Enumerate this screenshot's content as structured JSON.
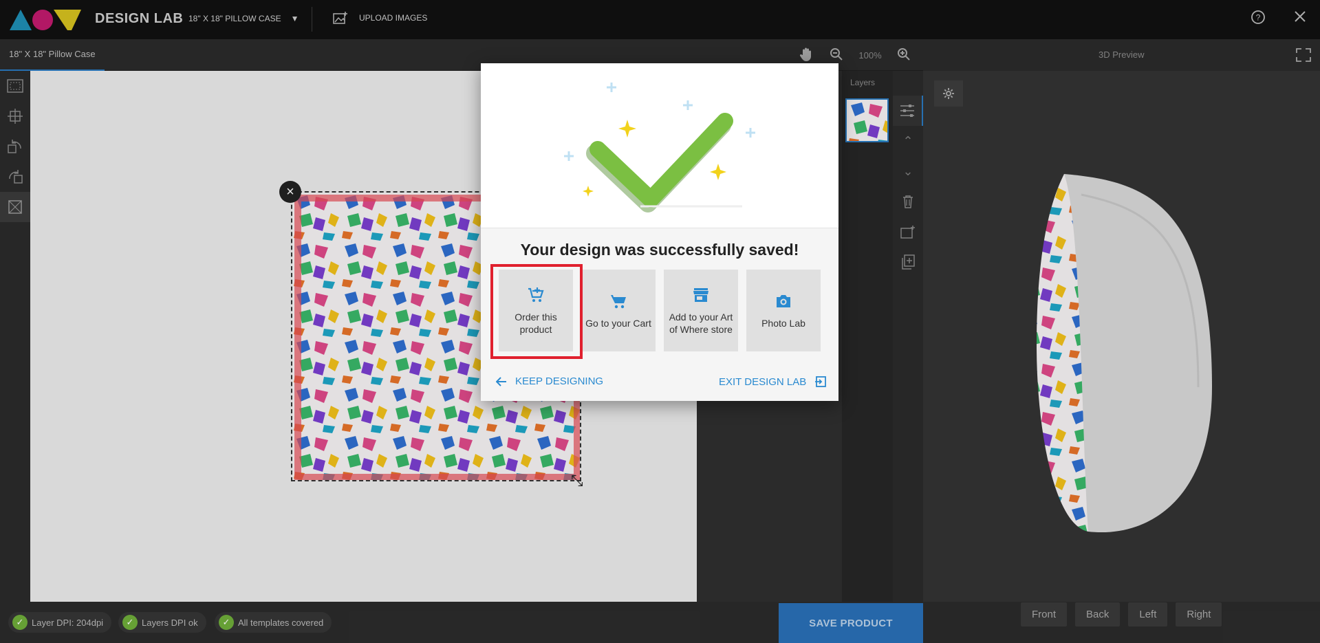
{
  "header": {
    "brand": "DESIGN LAB",
    "product": "18\" X 18\" PILLOW CASE",
    "upload_label": "UPLOAD IMAGES"
  },
  "subbar": {
    "tab": "18\" X 18\" Pillow Case",
    "zoom": "100%",
    "preview_title": "3D Preview"
  },
  "layers": {
    "label": "Layers"
  },
  "preview": {
    "views": [
      "Front",
      "Back",
      "Left",
      "Right"
    ]
  },
  "status": {
    "chips": [
      "Layer DPI: 204dpi",
      "Layers DPI ok",
      "All templates covered"
    ],
    "save_label": "SAVE PRODUCT"
  },
  "modal": {
    "title": "Your design was successfully saved!",
    "options": [
      {
        "label": "Order this product",
        "icon": "add-to-cart-icon"
      },
      {
        "label": "Go to your Cart",
        "icon": "cart-icon"
      },
      {
        "label": "Add to your Art of Where store",
        "icon": "store-icon"
      },
      {
        "label": "Photo Lab",
        "icon": "camera-icon"
      }
    ],
    "keep_label": "KEEP DESIGNING",
    "exit_label": "EXIT DESIGN LAB"
  },
  "colors": {
    "accent": "#2a8ad0",
    "success": "#7bbf42",
    "highlight": "#e0202e",
    "save": "#2a70b8"
  }
}
